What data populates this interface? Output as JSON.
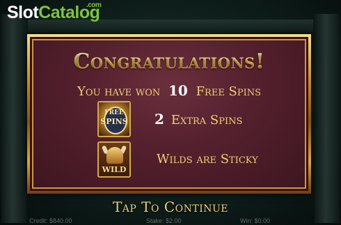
{
  "logo": {
    "part1": "Slot",
    "part2": "Catalog",
    "suffix": ".com"
  },
  "dialog": {
    "title": "Congratulations!",
    "won_prefix": "You have won",
    "won_count": "10",
    "won_suffix": "Free Spins",
    "rows": [
      {
        "icon": "free-spins-icon",
        "icon_text_top": "FREE",
        "icon_text_bottom": "SPINS",
        "count": "2",
        "text": "Extra Spins"
      },
      {
        "icon": "wild-icon",
        "icon_text": "WILD",
        "text": "Wilds are Sticky"
      }
    ]
  },
  "continue_label": "Tap To Continue",
  "status_bar": {
    "credit": "Credit: $840.00",
    "stake": "Stake: $2.00",
    "win": "Win: $0.00"
  },
  "colors": {
    "gold": "#f0cf7a",
    "panel": "#54202d",
    "logo_green": "#7dc242"
  }
}
